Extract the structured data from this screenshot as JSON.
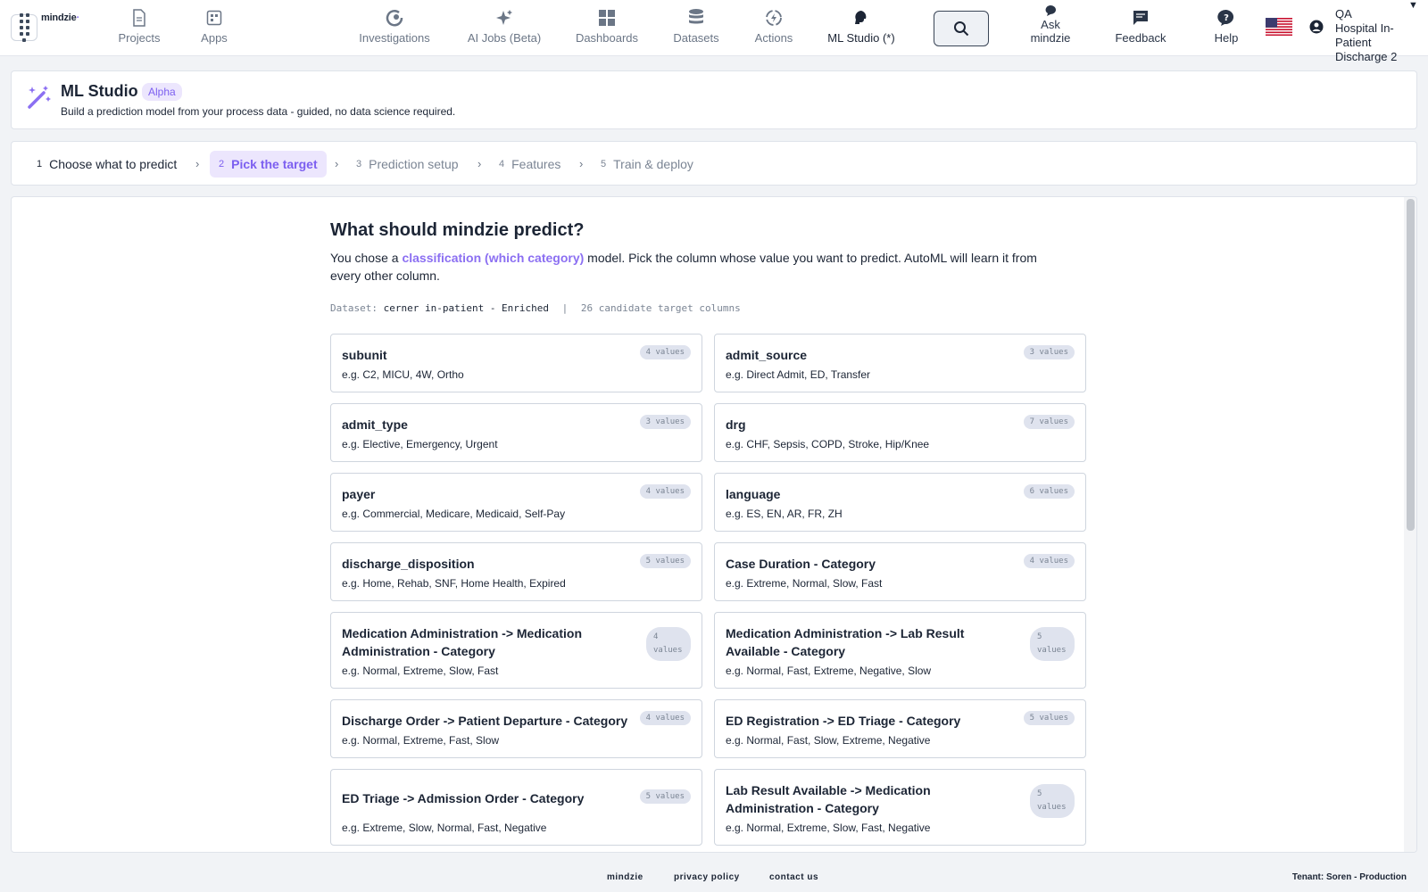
{
  "app": {
    "logo": "mindzie"
  },
  "nav": {
    "projects": "Projects",
    "apps": "Apps",
    "investigations": "Investigations",
    "ai_jobs": "AI Jobs (Beta)",
    "dashboards": "Dashboards",
    "datasets": "Datasets",
    "actions": "Actions",
    "ml_studio": "ML Studio (*)",
    "ask": "Ask mindzie",
    "feedback": "Feedback",
    "help": "Help"
  },
  "user": {
    "org_line1": "QA",
    "project": "Hospital In-Patient Discharge 2"
  },
  "header": {
    "title": "ML Studio",
    "badge": "Alpha",
    "subtitle": "Build a prediction model from your process data - guided, no data science required."
  },
  "steps": [
    {
      "num": "1",
      "label": "Choose what to predict"
    },
    {
      "num": "2",
      "label": "Pick the target"
    },
    {
      "num": "3",
      "label": "Prediction setup"
    },
    {
      "num": "4",
      "label": "Features"
    },
    {
      "num": "5",
      "label": "Train & deploy"
    }
  ],
  "main": {
    "title": "What should mindzie predict?",
    "desc_prefix": "You chose a ",
    "desc_highlight": "classification (which category)",
    "desc_suffix": " model. Pick the column whose value you want to predict. AutoML will learn it from every other column.",
    "dataset_label": "Dataset:",
    "dataset_name": "cerner in-patient - Enriched",
    "separator": "|",
    "candidates": "26 candidate target columns"
  },
  "cards": [
    {
      "name": "subunit",
      "examples": "e.g. C2, MICU, 4W, Ortho",
      "count": "4 values"
    },
    {
      "name": "admit_source",
      "examples": "e.g. Direct Admit, ED, Transfer",
      "count": "3 values"
    },
    {
      "name": "admit_type",
      "examples": "e.g. Elective, Emergency, Urgent",
      "count": "3 values"
    },
    {
      "name": "drg",
      "examples": "e.g. CHF, Sepsis, COPD, Stroke, Hip/Knee",
      "count": "7 values"
    },
    {
      "name": "payer",
      "examples": "e.g. Commercial, Medicare, Medicaid, Self-Pay",
      "count": "4 values"
    },
    {
      "name": "language",
      "examples": "e.g. ES, EN, AR, FR, ZH",
      "count": "6 values"
    },
    {
      "name": "discharge_disposition",
      "examples": "e.g. Home, Rehab, SNF, Home Health, Expired",
      "count": "5 values"
    },
    {
      "name": "Case Duration - Category",
      "examples": "e.g. Extreme, Normal, Slow, Fast",
      "count": "4 values"
    },
    {
      "name": "Medication Administration -> Medication Administration - Category",
      "examples": "e.g. Normal, Extreme, Slow, Fast",
      "count": "4 values"
    },
    {
      "name": "Medication Administration -> Lab Result Available - Category",
      "examples": "e.g. Normal, Fast, Extreme, Negative, Slow",
      "count": "5 values"
    },
    {
      "name": "Discharge Order -> Patient Departure - Category",
      "examples": "e.g. Normal, Extreme, Fast, Slow",
      "count": "4 values"
    },
    {
      "name": "ED Registration -> ED Triage - Category",
      "examples": "e.g. Normal, Fast, Slow, Extreme, Negative",
      "count": "5 values"
    },
    {
      "name": "ED Triage -> Admission Order - Category",
      "examples": "e.g. Extreme, Slow, Normal, Fast, Negative",
      "count": "5 values"
    },
    {
      "name": "Lab Result Available -> Medication Administration - Category",
      "examples": "e.g. Normal, Extreme, Slow, Fast, Negative",
      "count": "5 values"
    }
  ],
  "footer": {
    "brand": "mindzie",
    "privacy": "privacy policy",
    "contact": "contact us",
    "tenant": "Tenant: Soren - Production"
  },
  "colors": {
    "accent": "#8b6ff2",
    "accent_bg": "#ece6fd",
    "text": "#1c2535"
  }
}
